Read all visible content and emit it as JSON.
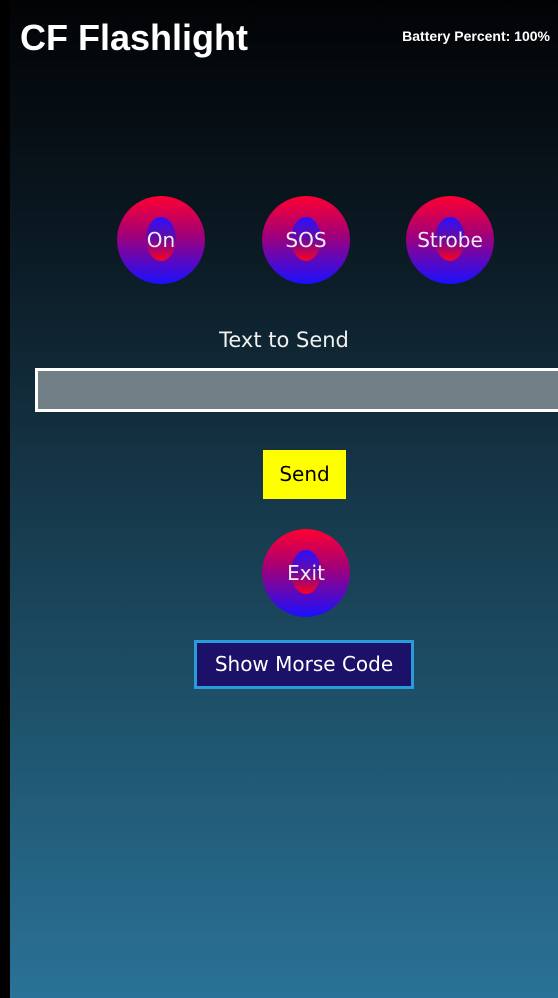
{
  "header": {
    "app_title": "CF Flashlight",
    "battery_status": "Battery Percent: 100%"
  },
  "modes": {
    "on_label": "On",
    "sos_label": "SOS",
    "strobe_label": "Strobe"
  },
  "message": {
    "prompt_label": "Text to Send",
    "input_value": "",
    "send_label": "Send"
  },
  "actions": {
    "exit_label": "Exit",
    "show_morse_label": "Show Morse Code"
  },
  "colors": {
    "send_button": "#ffff00",
    "morse_button_bg": "#1c1168",
    "morse_button_border": "#2a9ad8",
    "round_button_top": "#ff0030",
    "round_button_bottom": "#1a10ff"
  }
}
